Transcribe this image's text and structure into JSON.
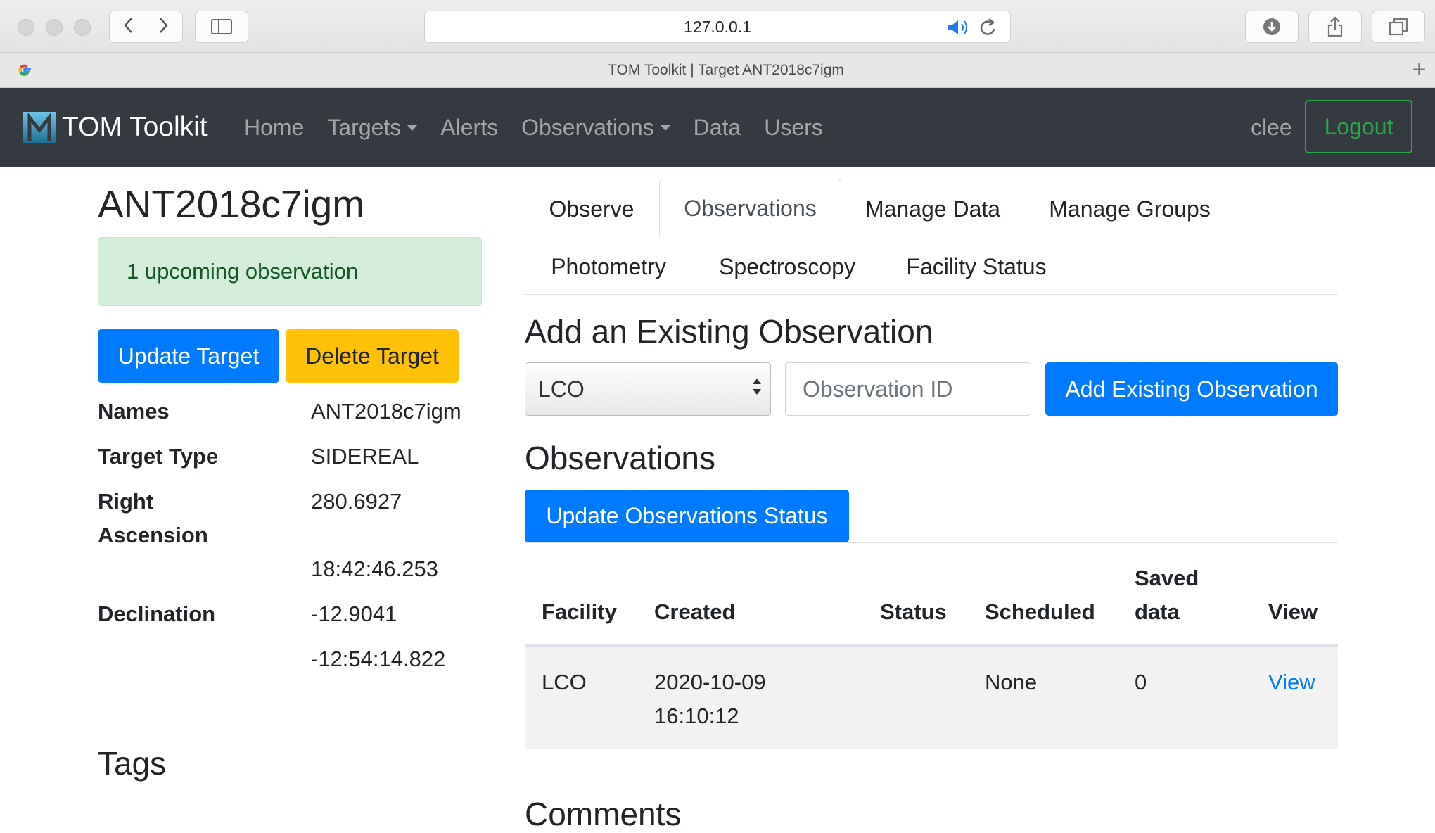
{
  "browser": {
    "url": "127.0.0.1",
    "tab_title": "TOM Toolkit | Target ANT2018c7igm",
    "new_tab": "+"
  },
  "navbar": {
    "brand": "TOM Toolkit",
    "links": [
      "Home",
      "Targets",
      "Alerts",
      "Observations",
      "Data",
      "Users"
    ],
    "user": "clee",
    "logout": "Logout"
  },
  "target": {
    "name": "ANT2018c7igm",
    "alert": "1 upcoming observation",
    "update_button": "Update Target",
    "delete_button": "Delete Target",
    "details": {
      "names_label": "Names",
      "names_value": "ANT2018c7igm",
      "type_label": "Target Type",
      "type_value": "SIDEREAL",
      "ra_label_line1": "Right",
      "ra_label_line2": "Ascension",
      "ra_value": "280.6927",
      "ra_sexagesimal": "18:42:46.253",
      "dec_label": "Declination",
      "dec_value": "-12.9041",
      "dec_sexagesimal": "-12:54:14.822"
    },
    "tags_title": "Tags"
  },
  "tabs": {
    "row1": [
      "Observe",
      "Observations",
      "Manage Data",
      "Manage Groups"
    ],
    "row2": [
      "Photometry",
      "Spectroscopy",
      "Facility Status"
    ],
    "active": "Observations"
  },
  "add_existing": {
    "title": "Add an Existing Observation",
    "facility_selected": "LCO",
    "observation_id_placeholder": "Observation ID",
    "submit": "Add Existing Observation"
  },
  "observations": {
    "title": "Observations",
    "update_status_button": "Update Observations Status",
    "headers": {
      "facility": "Facility",
      "created": "Created",
      "status": "Status",
      "scheduled": "Scheduled",
      "saved_line1": "Saved",
      "saved_line2": "data",
      "view": "View"
    },
    "rows": [
      {
        "facility": "LCO",
        "created_date": "2020-10-09",
        "created_time": "16:10:12",
        "status": "",
        "scheduled": "None",
        "saved_data": "0",
        "view": "View"
      }
    ]
  },
  "comments_title": "Comments",
  "colors": {
    "navbar": "#343a40",
    "primary": "#007bff",
    "warning": "#ffc107",
    "success": "#28a745",
    "alert_bg": "#d4edda"
  }
}
